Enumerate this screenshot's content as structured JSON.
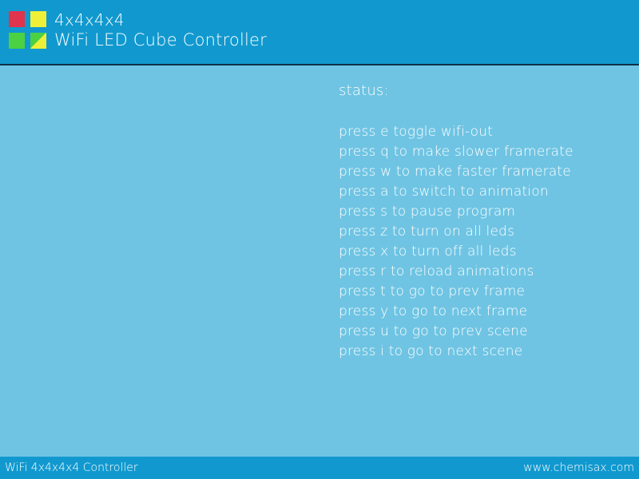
{
  "header": {
    "logo_colors": [
      "#e0334c",
      "#eef038",
      "#4cd142",
      "#4cd142/#eef038"
    ],
    "title_top": "4x4x4x4",
    "title_bottom": "WiFi LED Cube Controller"
  },
  "main": {
    "status_label": "status:",
    "commands": [
      "press e toggle wifi-out",
      "press q to make slower framerate",
      "press w to make faster framerate",
      "press a to switch to animation",
      "press s to pause program",
      "press z to turn on all leds",
      "press x to turn off all leds",
      "press r to reload animations",
      "press t to go to prev frame",
      "press y to go to next frame",
      "press u to go to prev scene",
      "press i to go to next scene"
    ]
  },
  "footer": {
    "left": "WiFi 4x4x4x4 Controller",
    "right": "www.chemisax.com"
  },
  "colors": {
    "header_bg": "#1199cf",
    "main_bg": "#6fc4e3",
    "text": "#ffffff",
    "divider": "#0f3047"
  }
}
